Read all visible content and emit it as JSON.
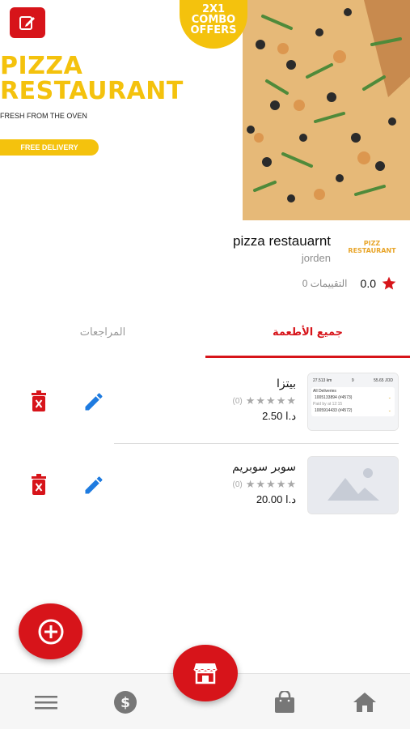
{
  "banner": {
    "title_line1": "PIZZA",
    "title_line2": "RESTAURANT",
    "subtitle": "FRESH FROM THE OVEN",
    "delivery": "FREE DELIVERY",
    "combo_line1": "2X1",
    "combo_line2": "COMBO",
    "combo_line3": "OFFERS",
    "accent_color": "#f4c20d"
  },
  "restaurant": {
    "name": "pizza restauarnt",
    "city": "jorden",
    "logo_line1": "PIZZ",
    "logo_line2": "RESTAURANT",
    "rating": "0.0",
    "ratings_label": "0 التقييمات"
  },
  "tabs": {
    "menu": "جميع الأطعمة",
    "reviews": "المراجعات"
  },
  "items": [
    {
      "name": "بيتزا",
      "count": "(0)",
      "price": "2.50 د.ا",
      "rating_stars": 0,
      "thumb": {
        "distance": "27.513 km",
        "qty": "9",
        "amount": "55.65 JOD",
        "header": "All Deliveries",
        "order1": "1005133894 (#4573)",
        "order2": "1005914433 (#4572)",
        "note": "Paid by at 12:15"
      }
    },
    {
      "name": "سوبر سوبريم",
      "count": "(0)",
      "price": "20.00 د.ا",
      "rating_stars": 0
    }
  ],
  "icons": {
    "edit": "edit-icon",
    "add": "plus-circle-icon",
    "store": "store-icon",
    "menu": "menu-icon",
    "dollar": "dollar-icon",
    "bag": "shopping-bag-icon",
    "home": "home-icon"
  },
  "colors": {
    "primary": "#d7141a",
    "edit_blue": "#1e7be0",
    "star_inactive": "#a9a9a9"
  }
}
